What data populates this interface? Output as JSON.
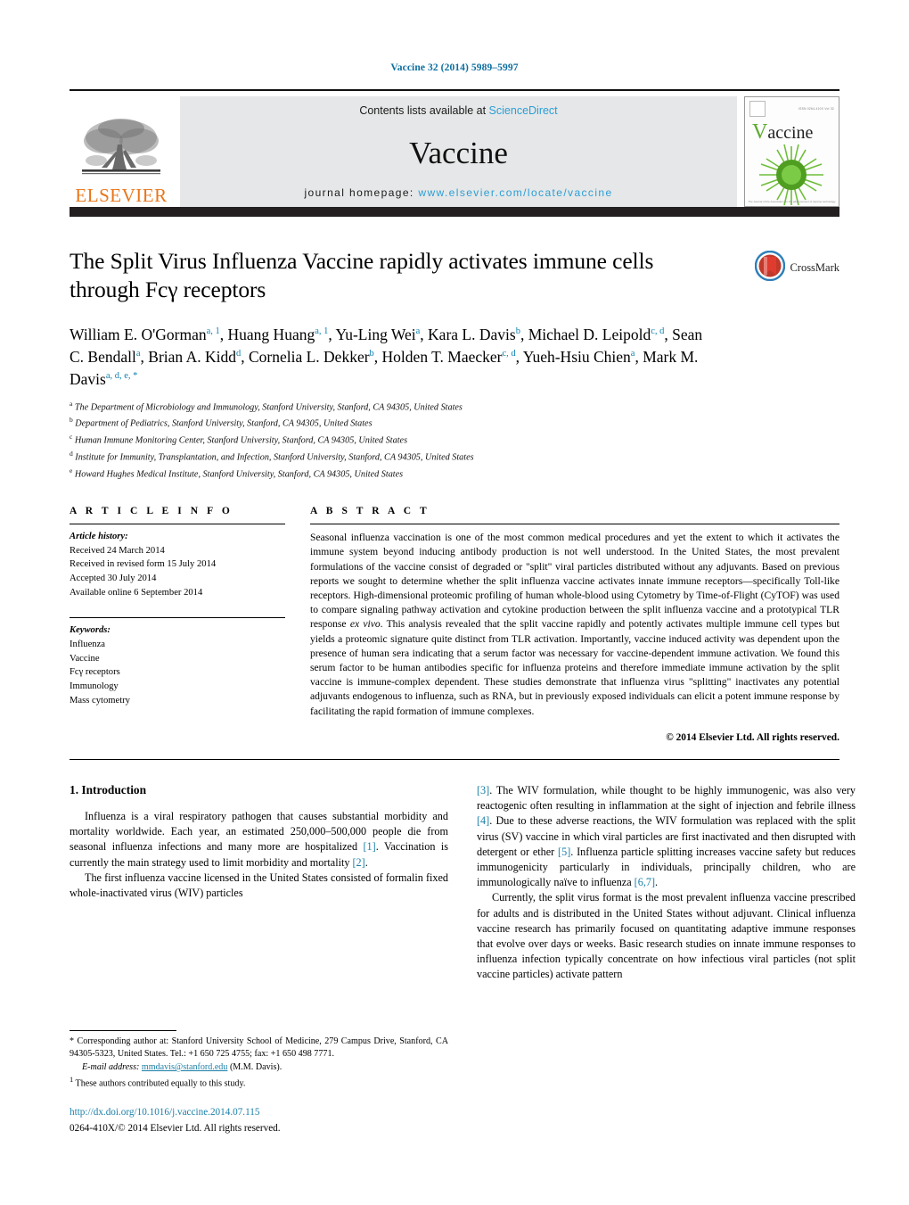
{
  "running_head": "Vaccine 32 (2014) 5989–5997",
  "masthead": {
    "publisher_logo_text": "ELSEVIER",
    "contents_prefix": "Contents lists available at ",
    "contents_link": "ScienceDirect",
    "journal_name": "Vaccine",
    "homepage_prefix": "journal homepage: ",
    "homepage_link": "www.elsevier.com/locate/vaccine",
    "cover": {
      "title_initial": "V",
      "title_rest": "accine",
      "top_note": "ISSN 0264-410X   Vol 32",
      "bottom_note": "The Journal of the Association for the advancement of vaccine technology"
    }
  },
  "article": {
    "title": "The Split Virus Influenza Vaccine rapidly activates immune cells through Fcγ receptors",
    "crossmark_label": "CrossMark",
    "authors_html": "William E. O'Gorman<sup>a, 1</sup>, Huang Huang<sup>a, 1</sup>, Yu-Ling Wei<sup>a</sup>, Kara L. Davis<sup>b</sup>, Michael D. Leipold<sup>c, d</sup>, Sean C. Bendall<sup>a</sup>, Brian A. Kidd<sup>d</sup>, Cornelia L. Dekker<sup>b</sup>, Holden T. Maecker<sup>c, d</sup>, Yueh-Hsiu Chien<sup>a</sup>, Mark M. Davis<sup>a, d, e, *</sup>",
    "affiliations": [
      {
        "mark": "a",
        "text": "The Department of Microbiology and Immunology, Stanford University, Stanford, CA 94305, United States"
      },
      {
        "mark": "b",
        "text": "Department of Pediatrics, Stanford University, Stanford, CA 94305, United States"
      },
      {
        "mark": "c",
        "text": "Human Immune Monitoring Center, Stanford University, Stanford, CA 94305, United States"
      },
      {
        "mark": "d",
        "text": "Institute for Immunity, Transplantation, and Infection, Stanford University, Stanford, CA 94305, United States"
      },
      {
        "mark": "e",
        "text": "Howard Hughes Medical Institute, Stanford University, Stanford, CA 94305, United States"
      }
    ]
  },
  "article_info": {
    "heading": "A R T I C L E    I N F O",
    "history_label": "Article history:",
    "history": [
      "Received 24 March 2014",
      "Received in revised form 15 July 2014",
      "Accepted 30 July 2014",
      "Available online 6 September 2014"
    ],
    "keywords_label": "Keywords:",
    "keywords": [
      "Influenza",
      "Vaccine",
      "Fcγ receptors",
      "Immunology",
      "Mass cytometry"
    ]
  },
  "abstract": {
    "heading": "A B S T R A C T",
    "text_html": "Seasonal influenza vaccination is one of the most common medical procedures and yet the extent to which it activates the immune system beyond inducing antibody production is not well understood. In the United States, the most prevalent formulations of the vaccine consist of degraded or \"split\" viral particles distributed without any adjuvants. Based on previous reports we sought to determine whether the split influenza vaccine activates innate immune receptors—specifically Toll-like receptors. High-dimensional proteomic profiling of human whole-blood using Cytometry by Time-of-Flight (CyTOF) was used to compare signaling pathway activation and cytokine production between the split influenza vaccine and a prototypical TLR response <em>ex vivo</em>. This analysis revealed that the split vaccine rapidly and potently activates multiple immune cell types but yields a proteomic signature quite distinct from TLR activation. Importantly, vaccine induced activity was dependent upon the presence of human sera indicating that a serum factor was necessary for vaccine-dependent immune activation. We found this serum factor to be human antibodies specific for influenza proteins and therefore immediate immune activation by the split vaccine is immune-complex dependent. These studies demonstrate that influenza virus \"splitting\" inactivates any potential adjuvants endogenous to influenza, such as RNA, but in previously exposed individuals can elicit a potent immune response by facilitating the rapid formation of immune complexes.",
    "copyright": "© 2014 Elsevier Ltd. All rights reserved."
  },
  "introduction": {
    "number_title": "1.  Introduction",
    "left_paragraphs_html": [
      "Influenza is a viral respiratory pathogen that causes substantial morbidity and mortality worldwide. Each year, an estimated 250,000–500,000 people die from seasonal influenza infections and many more are hospitalized <span class=\"ref\">[1]</span>. Vaccination is currently the main strategy used to limit morbidity and mortality <span class=\"ref\">[2]</span>.",
      "The first influenza vaccine licensed in the United States consisted of formalin fixed whole-inactivated virus (WIV) particles"
    ],
    "right_paragraphs_html": [
      "<span class=\"ref\">[3]</span>. The WIV formulation, while thought to be highly immunogenic, was also very reactogenic often resulting in inflammation at the sight of injection and febrile illness <span class=\"ref\">[4]</span>. Due to these adverse reactions, the WIV formulation was replaced with the split virus (SV) vaccine in which viral particles are first inactivated and then disrupted with detergent or ether <span class=\"ref\">[5]</span>. Influenza particle splitting increases vaccine safety but reduces immunogenicity particularly in individuals, principally children, who are immunologically naïve to influenza <span class=\"ref\">[6,7]</span>.",
      "Currently, the split virus format is the most prevalent influenza vaccine prescribed for adults and is distributed in the United States without adjuvant. Clinical influenza vaccine research has primarily focused on quantitating adaptive immune responses that evolve over days or weeks. Basic research studies on innate immune responses to influenza infection typically concentrate on how infectious viral particles (not split vaccine particles) activate pattern"
    ]
  },
  "footnotes": {
    "corresponding_html": "<span class=\"marker\">*</span>  Corresponding author at: Stanford University School of Medicine, 279 Campus Drive, Stanford, CA 94305-5323, United States. Tel.: +1 650 725 4755; fax: +1 650 498 7771.",
    "email_label": "E-mail address:",
    "email_link": "mmdavis@stanford.edu",
    "email_suffix": "(M.M. Davis).",
    "equal_contrib_html": "<sup>1</sup>  These authors contributed equally to this study.",
    "doi": "http://dx.doi.org/10.1016/j.vaccine.2014.07.115",
    "issn_line": "0264-410X/© 2014 Elsevier Ltd. All rights reserved."
  },
  "colors": {
    "link_blue": "#1a7fa8",
    "sciencedirect_blue": "#2a9fd6",
    "elsevier_orange": "#e8761b",
    "masthead_gray": "#e6e7e8",
    "black_bar": "#231f20"
  }
}
